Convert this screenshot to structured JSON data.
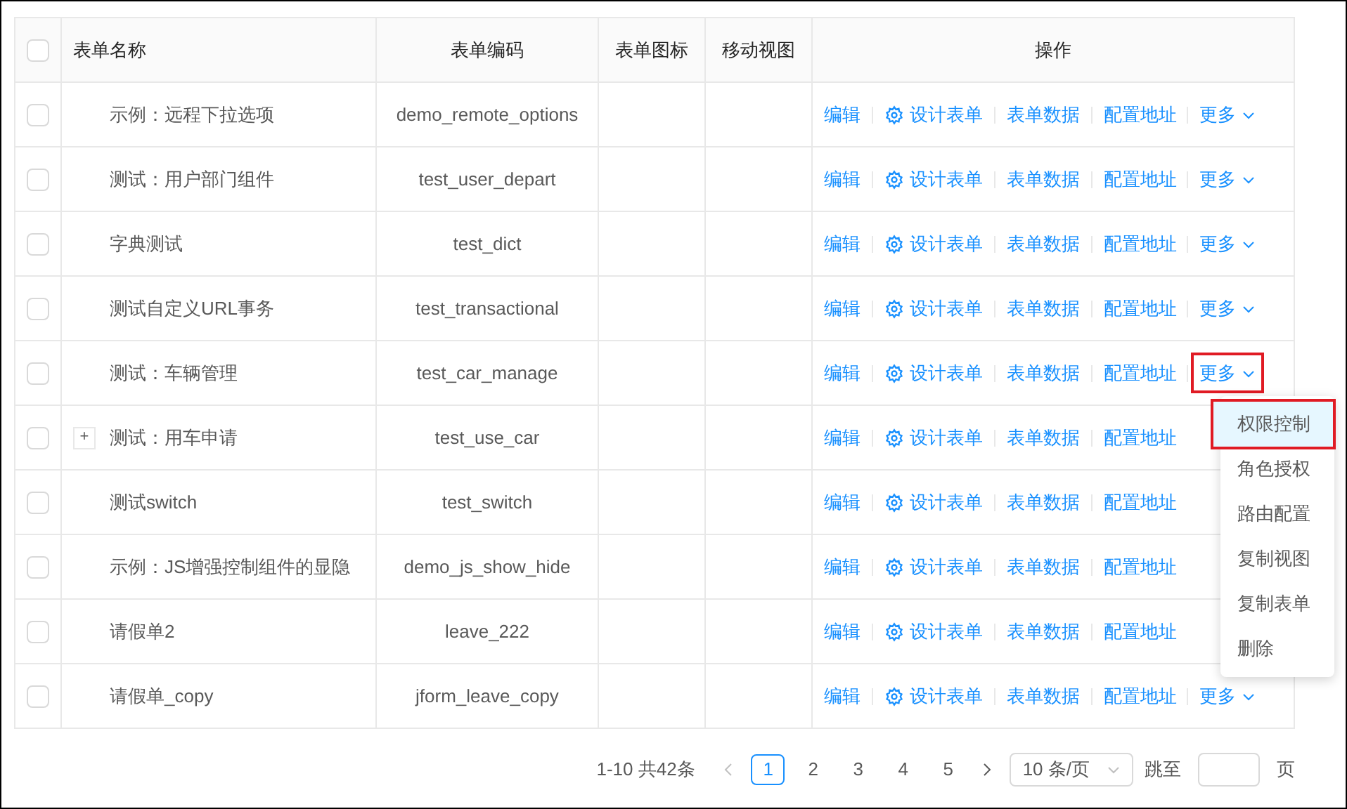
{
  "table": {
    "header_checkbox": {
      "checked": false
    },
    "columns": [
      "表单名称",
      "表单编码",
      "表单图标",
      "移动视图",
      "操作"
    ],
    "rows": [
      {
        "checked": false,
        "expandable": false,
        "name": "示例：远程下拉选项",
        "code": "demo_remote_options",
        "actions": [
          "编辑",
          "设计表单",
          "表单数据",
          "配置地址"
        ],
        "more": {
          "label": "更多",
          "highlighted": false
        }
      },
      {
        "checked": false,
        "expandable": false,
        "name": "测试：用户部门组件",
        "code": "test_user_depart",
        "actions": [
          "编辑",
          "设计表单",
          "表单数据",
          "配置地址"
        ],
        "more": {
          "label": "更多",
          "highlighted": false
        }
      },
      {
        "checked": false,
        "expandable": false,
        "name": "字典测试",
        "code": "test_dict",
        "actions": [
          "编辑",
          "设计表单",
          "表单数据",
          "配置地址"
        ],
        "more": {
          "label": "更多",
          "highlighted": false
        }
      },
      {
        "checked": false,
        "expandable": false,
        "name": "测试自定义URL事务",
        "code": "test_transactional",
        "actions": [
          "编辑",
          "设计表单",
          "表单数据",
          "配置地址"
        ],
        "more": {
          "label": "更多",
          "highlighted": false
        }
      },
      {
        "checked": false,
        "expandable": false,
        "name": "测试：车辆管理",
        "code": "test_car_manage",
        "actions": [
          "编辑",
          "设计表单",
          "表单数据",
          "配置地址"
        ],
        "more": {
          "label": "更多",
          "highlighted": true
        }
      },
      {
        "checked": false,
        "expandable": true,
        "expand_symbol": "+",
        "name": "测试：用车申请",
        "code": "test_use_car",
        "actions": [
          "编辑",
          "设计表单",
          "表单数据",
          "配置地址"
        ]
      },
      {
        "checked": false,
        "expandable": false,
        "name": "测试switch",
        "code": "test_switch",
        "actions": [
          "编辑",
          "设计表单",
          "表单数据",
          "配置地址"
        ]
      },
      {
        "checked": false,
        "expandable": false,
        "name": "示例：JS增强控制组件的显隐",
        "code": "demo_js_show_hide",
        "actions": [
          "编辑",
          "设计表单",
          "表单数据",
          "配置地址"
        ]
      },
      {
        "checked": false,
        "expandable": false,
        "name": "请假单2",
        "code": "leave_222",
        "actions": [
          "编辑",
          "设计表单",
          "表单数据",
          "配置地址"
        ]
      },
      {
        "checked": false,
        "expandable": false,
        "name": "请假单_copy",
        "code": "jform_leave_copy",
        "actions": [
          "编辑",
          "设计表单",
          "表单数据",
          "配置地址"
        ],
        "more": {
          "label": "更多",
          "highlighted": false
        }
      }
    ]
  },
  "dropdown_menu": {
    "items": [
      {
        "label": "权限控制",
        "selected": true,
        "highlighted": true
      },
      {
        "label": "角色授权",
        "selected": false,
        "highlighted": false
      },
      {
        "label": "路由配置",
        "selected": false,
        "highlighted": false
      },
      {
        "label": "复制视图",
        "selected": false,
        "highlighted": false
      },
      {
        "label": "复制表单",
        "selected": false,
        "highlighted": false
      },
      {
        "label": "删除",
        "selected": false,
        "highlighted": false
      }
    ]
  },
  "pagination": {
    "total": "1-10 共42条",
    "prev_disabled": true,
    "pages": [
      {
        "label": "1",
        "selected": true
      },
      {
        "label": "2",
        "selected": false
      },
      {
        "label": "3",
        "selected": false
      },
      {
        "label": "4",
        "selected": false
      },
      {
        "label": "5",
        "selected": false
      }
    ],
    "page_size": "10 条/页",
    "jump_label": "跳至",
    "page_suffix": "页"
  }
}
